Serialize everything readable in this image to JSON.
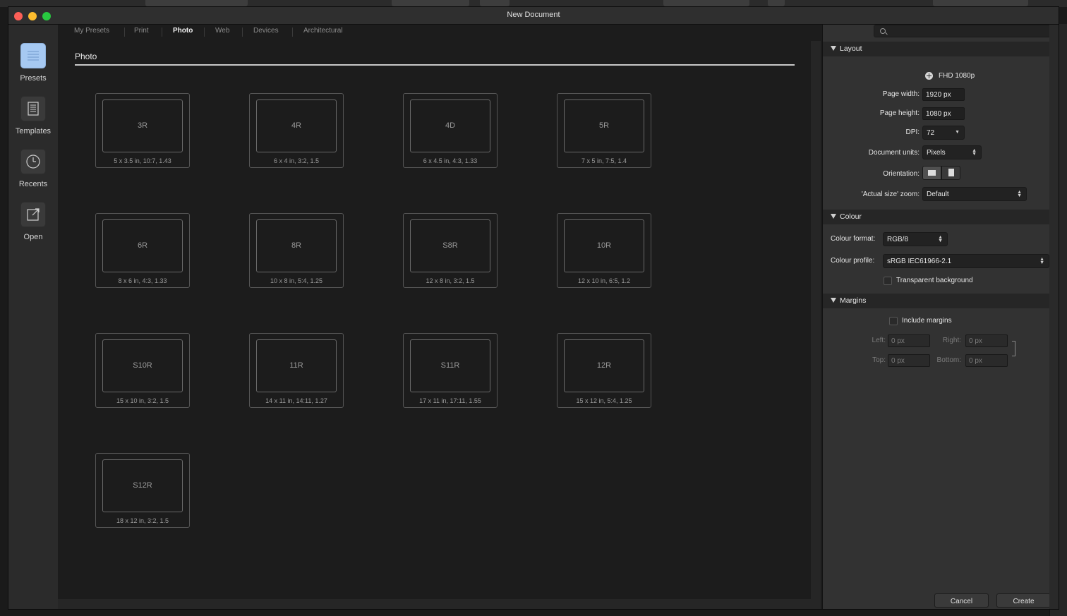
{
  "window": {
    "title": "New Document"
  },
  "nav": [
    {
      "label": "Presets",
      "icon": "presets-icon",
      "active": true
    },
    {
      "label": "Templates",
      "icon": "templates-icon"
    },
    {
      "label": "Recents",
      "icon": "recents-icon"
    },
    {
      "label": "Open",
      "icon": "open-icon"
    }
  ],
  "tabs": [
    "My Presets",
    "Print",
    "Photo",
    "Web",
    "Devices",
    "Architectural"
  ],
  "active_tab": "Photo",
  "section_title": "Photo",
  "presets": [
    {
      "name": "3R",
      "desc": "5 x 3.5 in, 10:7, 1.43"
    },
    {
      "name": "4R",
      "desc": "6 x 4 in, 3:2, 1.5"
    },
    {
      "name": "4D",
      "desc": "6 x 4.5 in, 4:3, 1.33"
    },
    {
      "name": "5R",
      "desc": "7 x 5 in, 7:5, 1.4"
    },
    {
      "name": "6R",
      "desc": "8 x 6 in, 4:3, 1.33"
    },
    {
      "name": "8R",
      "desc": "10 x 8 in, 5:4, 1.25"
    },
    {
      "name": "S8R",
      "desc": "12 x 8 in, 3:2, 1.5"
    },
    {
      "name": "10R",
      "desc": "12 x 10 in, 6:5, 1.2"
    },
    {
      "name": "S10R",
      "desc": "15 x 10 in, 3:2, 1.5"
    },
    {
      "name": "11R",
      "desc": "14 x 11 in, 14:11, 1.27"
    },
    {
      "name": "S11R",
      "desc": "17 x 11 in, 17:11, 1.55"
    },
    {
      "name": "12R",
      "desc": "15 x 12 in, 5:4, 1.25"
    },
    {
      "name": "S12R",
      "desc": "18 x 12 in, 3:2, 1.5"
    }
  ],
  "panel": {
    "search_placeholder": "",
    "layout": {
      "header": "Layout",
      "preset_name": "FHD 1080p",
      "page_width_label": "Page width:",
      "page_width": "1920 px",
      "page_height_label": "Page height:",
      "page_height": "1080 px",
      "dpi_label": "DPI:",
      "dpi": "72",
      "units_label": "Document units:",
      "units": "Pixels",
      "orientation_label": "Orientation:",
      "zoom_label": "'Actual size' zoom:",
      "zoom": "Default"
    },
    "colour": {
      "header": "Colour",
      "format_label": "Colour format:",
      "format": "RGB/8",
      "profile_label": "Colour profile:",
      "profile": "sRGB IEC61966-2.1",
      "transparent_label": "Transparent background"
    },
    "margins": {
      "header": "Margins",
      "include_label": "Include margins",
      "left_label": "Left:",
      "left": "0 px",
      "right_label": "Right:",
      "right": "0 px",
      "top_label": "Top:",
      "top": "0 px",
      "bottom_label": "Bottom:",
      "bottom": "0 px"
    },
    "cancel": "Cancel",
    "create": "Create"
  }
}
